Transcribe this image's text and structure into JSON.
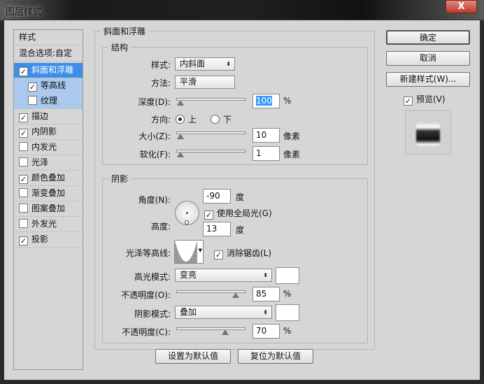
{
  "window": {
    "title": "图层样式",
    "close": "X"
  },
  "left": {
    "header": "样式",
    "blend": "混合选项:自定",
    "items": [
      {
        "label": "斜面和浮雕",
        "checked": true,
        "state": "selected"
      },
      {
        "label": "等高线",
        "checked": true,
        "state": "sub"
      },
      {
        "label": "纹理",
        "checked": false,
        "state": "sub"
      },
      {
        "label": "描边",
        "checked": true,
        "state": ""
      },
      {
        "label": "内阴影",
        "checked": true,
        "state": ""
      },
      {
        "label": "内发光",
        "checked": false,
        "state": ""
      },
      {
        "label": "光泽",
        "checked": false,
        "state": ""
      },
      {
        "label": "颜色叠加",
        "checked": true,
        "state": ""
      },
      {
        "label": "渐变叠加",
        "checked": false,
        "state": ""
      },
      {
        "label": "图案叠加",
        "checked": false,
        "state": ""
      },
      {
        "label": "外发光",
        "checked": false,
        "state": ""
      },
      {
        "label": "投影",
        "checked": true,
        "state": ""
      }
    ]
  },
  "bevel": {
    "title": "斜面和浮雕",
    "structure": {
      "title": "结构",
      "style_label": "样式:",
      "style_value": "内斜面",
      "method_label": "方法:",
      "method_value": "平滑",
      "depth_label": "深度(D):",
      "depth_value": "100",
      "depth_pct": 0,
      "depth_unit": "%",
      "direction_label": "方向:",
      "dir_up": "上",
      "dir_down": "下",
      "size_label": "大小(Z):",
      "size_value": "10",
      "size_unit": "像素",
      "size_pct": 0,
      "soften_label": "软化(F):",
      "soften_value": "1",
      "soften_unit": "像素",
      "soften_pct": 0
    },
    "shading": {
      "title": "阴影",
      "angle_label": "角度(N):",
      "angle_value": "-90",
      "angle_unit": "度",
      "global_light": "使用全局光(G)",
      "altitude_label": "高度:",
      "altitude_value": "13",
      "altitude_unit": "度",
      "gloss_label": "光泽等高线:",
      "antialias": "消除锯齿(L)",
      "highlight_label": "高光模式:",
      "highlight_mode": "变亮",
      "highlight_color": "#ffffff",
      "hl_opacity_label": "不透明度(O):",
      "hl_opacity": "85",
      "hl_opacity_pct": 85,
      "pct": "%",
      "shadow_label": "阴影模式:",
      "shadow_mode": "叠加",
      "shadow_color": "#ffffff",
      "sh_opacity_label": "不透明度(C):",
      "sh_opacity": "70",
      "sh_opacity_pct": 70
    }
  },
  "buttons": {
    "default_set": "设置为默认值",
    "default_reset": "复位为默认值",
    "ok": "确定",
    "cancel": "取消",
    "new_style": "新建样式(W)...",
    "preview": "预览(V)"
  },
  "colors": {
    "selection": "#3d8ee9",
    "sub_selection": "#a9c9ee"
  }
}
